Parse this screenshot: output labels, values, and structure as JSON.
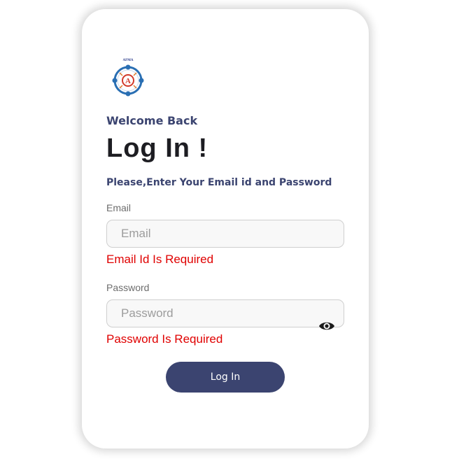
{
  "logo": {
    "icon": "institute-logo-icon",
    "caption": "AFMA"
  },
  "heading": {
    "welcome": "Welcome Back",
    "title": "Log In !",
    "instruction": "Please,Enter Your Email id and Password"
  },
  "form": {
    "email": {
      "label": "Email",
      "placeholder": "Email",
      "value": "",
      "error": "Email Id Is Required"
    },
    "password": {
      "label": "Password",
      "placeholder": "Password",
      "value": "",
      "error": "Password Is Required",
      "toggle_icon": "eye-icon"
    },
    "submit_label": "Log In"
  },
  "colors": {
    "primary": "#3b4470",
    "error": "#e00000",
    "title": "#1d1d22",
    "input_bg": "#f8f8f8",
    "input_border": "#cfcfcf"
  }
}
